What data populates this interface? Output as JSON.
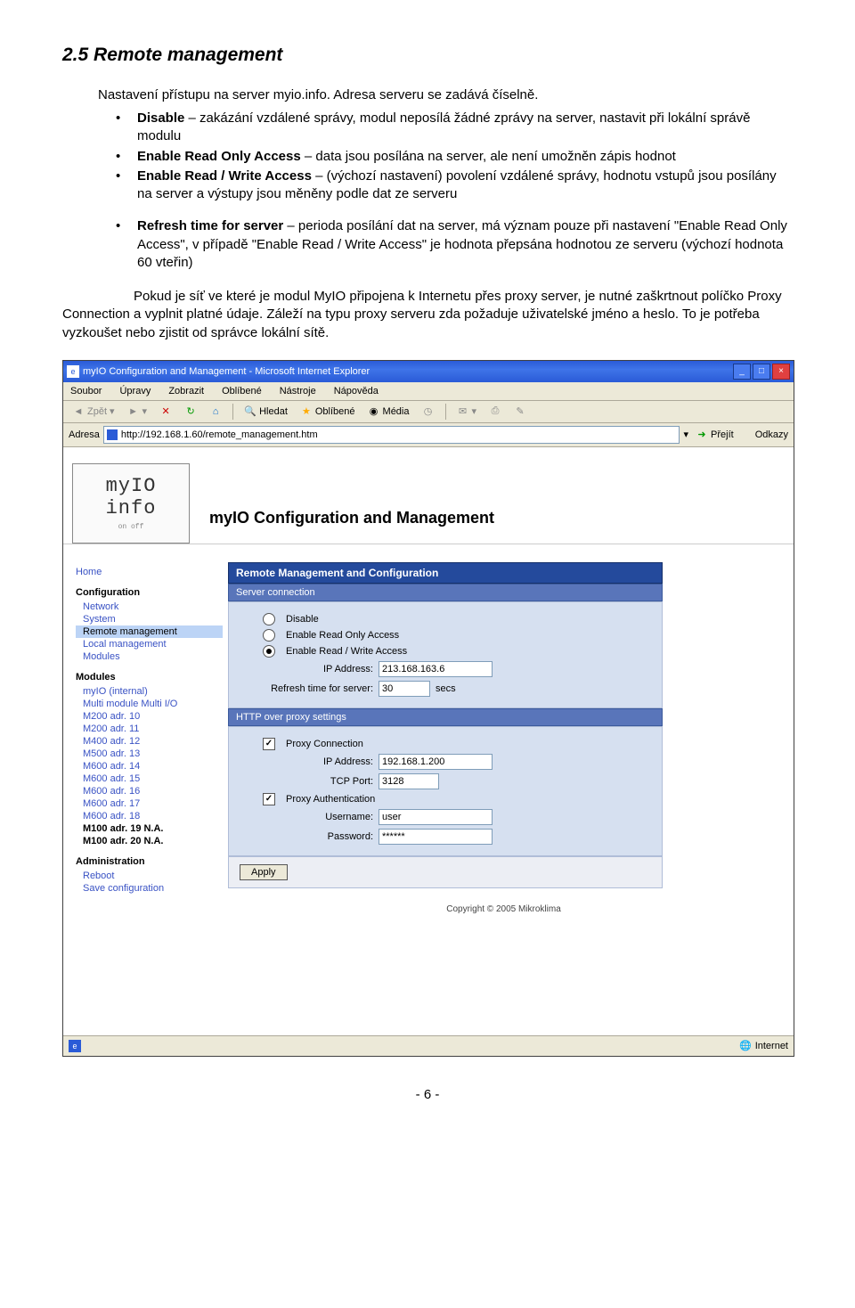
{
  "doc": {
    "section_title": "2.5  Remote management",
    "intro": "Nastavení přístupu na server myio.info. Adresa serveru se zadává číselně.",
    "list1": [
      "<b>Disable</b> – zakázání vzdálené správy, modul neposílá žádné zprávy na server, nastavit při lokální správě modulu",
      "<b>Enable Read Only Access</b> – data jsou posílána na server, ale není umožněn zápis hodnot",
      "<b>Enable Read / Write Access</b> – (výchozí nastavení) povolení vzdálené správy, hodnotu vstupů jsou posílány na server a výstupy jsou měněny podle dat ze serveru"
    ],
    "list2": [
      "<b>Refresh time for server</b> – perioda posílání dat na server, má význam pouze při nastavení \"Enable Read Only Access\", v případě \"Enable Read / Write Access\" je hodnota přepsána hodnotou ze serveru (výchozí hodnota 60 vteřin)"
    ],
    "closing1": "Pokud je síť ve které je modul MyIO připojena k Internetu přes proxy server, je nutné zaškrtnout políčko Proxy Connection a vyplnit platné údaje. Záleží na typu proxy serveru zda požaduje uživatelské jméno a heslo. To je potřeba vyzkoušet nebo zjistit od správce lokální sítě.",
    "page_number": "- 6 -"
  },
  "browser": {
    "title": "myIO Configuration and Management - Microsoft Internet Explorer",
    "menu": [
      "Soubor",
      "Úpravy",
      "Zobrazit",
      "Oblíbené",
      "Nástroje",
      "Nápověda"
    ],
    "toolbar": {
      "back": "Zpět",
      "search": "Hledat",
      "favorites": "Oblíbené",
      "media": "Média"
    },
    "address_label": "Adresa",
    "url": "http://192.168.1.60/remote_management.htm",
    "go": "Přejít",
    "links": "Odkazy",
    "status_zone": "Internet"
  },
  "app": {
    "logo_line1": "myIO",
    "logo_line2": "info",
    "title": "myIO  Configuration and Management",
    "nav": {
      "home": "Home",
      "config_head": "Configuration",
      "config_items": [
        "Network",
        "System",
        "Remote management",
        "Local management",
        "Modules"
      ],
      "modules_head": "Modules",
      "modules_items": [
        "myIO (internal)",
        "Multi module Multi I/O",
        "M200 adr. 10",
        "M200 adr. 11",
        "M400 adr. 12",
        "M500 adr. 13",
        "M600 adr. 14",
        "M600 adr. 15",
        "M600 adr. 16",
        "M600 adr. 17",
        "M600 adr. 18",
        "M100 adr. 19 N.A.",
        "M100 adr. 20 N.A."
      ],
      "admin_head": "Administration",
      "admin_items": [
        "Reboot",
        "Save configuration"
      ]
    },
    "panel": {
      "head": "Remote Management and Configuration",
      "sub1": "Server connection",
      "radios": [
        "Disable",
        "Enable Read Only Access",
        "Enable Read / Write Access"
      ],
      "ip_label": "IP Address:",
      "ip_value": "213.168.163.6",
      "refresh_label": "Refresh time for server:",
      "refresh_value": "30",
      "refresh_unit": "secs",
      "sub2": "HTTP over proxy settings",
      "proxy_conn": "Proxy Connection",
      "proxy_ip_label": "IP Address:",
      "proxy_ip_value": "192.168.1.200",
      "proxy_port_label": "TCP Port:",
      "proxy_port_value": "3128",
      "proxy_auth": "Proxy Authentication",
      "user_label": "Username:",
      "user_value": "user",
      "pass_label": "Password:",
      "pass_value": "******",
      "apply": "Apply"
    },
    "copyright": "Copyright © 2005 Mikroklima"
  }
}
